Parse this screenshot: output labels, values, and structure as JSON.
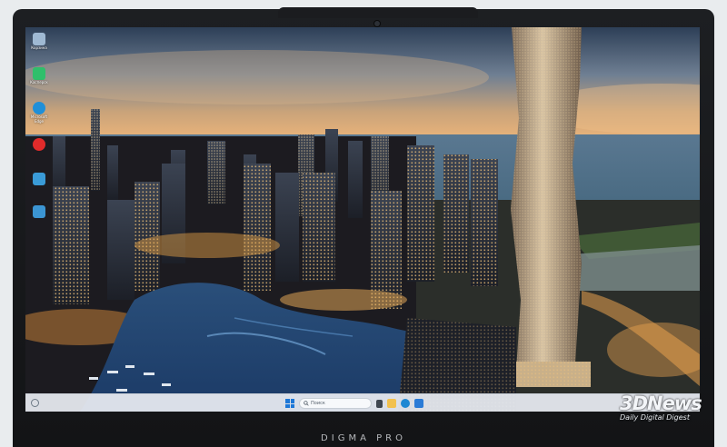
{
  "desktop": {
    "icons": [
      {
        "label": "Корзина",
        "color": "#9fb9d3"
      },
      {
        "label": "Касперск",
        "color": "#2fbf6b"
      },
      {
        "label": "Microsoft Edge",
        "color": "#1f8fd8"
      },
      {
        "label": "",
        "color": "#e12b2b"
      },
      {
        "label": "",
        "color": "#3a9bd7"
      },
      {
        "label": "",
        "color": "#3b95d3"
      },
      {
        "label": "",
        "color": "#4aa0e0"
      }
    ]
  },
  "taskbar": {
    "search_placeholder": "Поиск",
    "apps": [
      {
        "name": "task-view",
        "color": "#3e4650"
      },
      {
        "name": "file-explorer",
        "color": "#f2c14e"
      },
      {
        "name": "edge",
        "color": "#1e88d3"
      },
      {
        "name": "store",
        "color": "#2a7bd6"
      }
    ]
  },
  "device": {
    "brand": "DIGMA PRO"
  },
  "watermark": {
    "logo": "3DNews",
    "tagline": "Daily Digital Digest"
  }
}
